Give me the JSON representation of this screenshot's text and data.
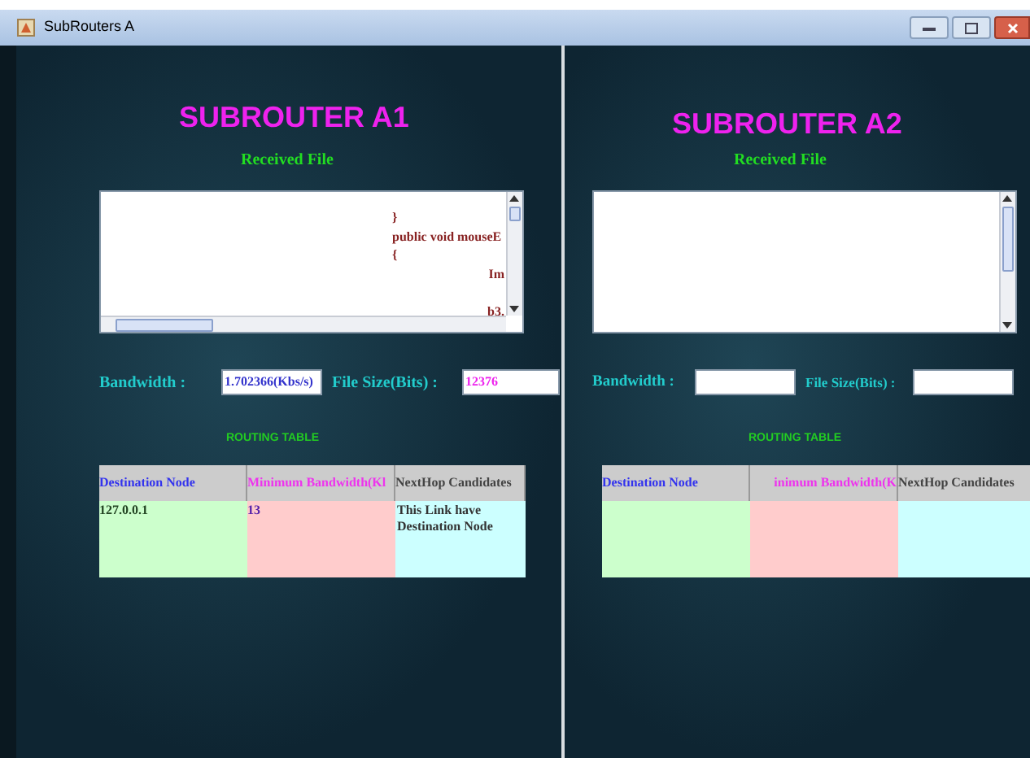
{
  "window": {
    "title": "SubRouters A"
  },
  "panels": [
    {
      "title": "SUBROUTER A1",
      "received_label": "Received File",
      "code_lines": [
        {
          "text": "}",
          "kind": "plain"
        },
        {
          "text": "public void mouseE",
          "kind": "plain"
        },
        {
          "text": "{",
          "kind": "plain"
        },
        {
          "text": "Im",
          "kind": "indented"
        },
        {
          "kind": "blank"
        },
        {
          "text": "b3.",
          "kind": "indented"
        }
      ],
      "horizontal_scrollbar": true,
      "bandwidth_label": "Bandwidth   :",
      "bandwidth_value": "1.702366(Kbs/s)",
      "filesize_label": "File Size(Bits)  :",
      "filesize_value": "12376",
      "table_label": "ROUTING TABLE",
      "columns": [
        "Destination Node",
        "Minimum Bandwidth(Kl",
        "NextHop Candidates"
      ],
      "rows": [
        [
          "127.0.0.1",
          "13",
          "This Link have Destination Node"
        ]
      ]
    },
    {
      "title": "SUBROUTER A2",
      "received_label": "Received File",
      "horizontal_scrollbar": false,
      "bandwidth_label": "Bandwidth   :",
      "filesize_label": "File Size(Bits)  :",
      "table_label": "ROUTING TABLE",
      "columns": [
        "Destination Node",
        "inimum Bandwidth(K",
        "NextHop Candidates"
      ]
    }
  ]
}
